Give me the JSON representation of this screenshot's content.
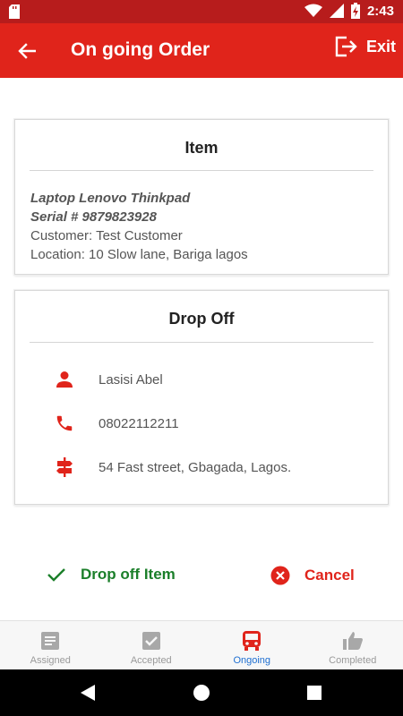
{
  "status_bar": {
    "time": "2:43",
    "battery_level_text": "",
    "icons": [
      "sd-card-icon",
      "wifi-icon",
      "signal-icon",
      "battery-charging-icon"
    ]
  },
  "app_bar": {
    "title": "On going Order",
    "exit_label": "Exit",
    "background_color": "#e0241b",
    "icons": [
      "back-arrow-icon",
      "exit-icon"
    ]
  },
  "item_card": {
    "title": "Item",
    "product_name": "Laptop Lenovo Thinkpad",
    "serial": "Serial # 9879823928",
    "customer": "Customer: Test Customer",
    "location": "Location: 10 Slow lane, Bariga lagos"
  },
  "drop_off_card": {
    "title": "Drop Off",
    "contact_name": "Lasisi Abel",
    "phone": "08022112211",
    "address": "54 Fast street, Gbagada, Lagos.",
    "icon_color": "#e0241b",
    "icons": [
      "person-icon",
      "phone-icon",
      "signpost-icon"
    ]
  },
  "actions": {
    "drop_off_label": "Drop off Item",
    "cancel_label": "Cancel",
    "drop_off_color": "#1b7f2a",
    "cancel_color": "#e0241b"
  },
  "bottom_nav": {
    "items": [
      {
        "label": "Assigned",
        "icon": "assignment-icon",
        "active": false
      },
      {
        "label": "Accepted",
        "icon": "check-box-icon",
        "active": false
      },
      {
        "label": "Ongoing",
        "icon": "bus-icon",
        "active": true
      },
      {
        "label": "Completed",
        "icon": "thumbs-up-icon",
        "active": false
      }
    ],
    "active_color": "#1f6fd1"
  },
  "system_nav": {
    "icons": [
      "back-triangle-icon",
      "home-circle-icon",
      "recents-square-icon"
    ]
  }
}
